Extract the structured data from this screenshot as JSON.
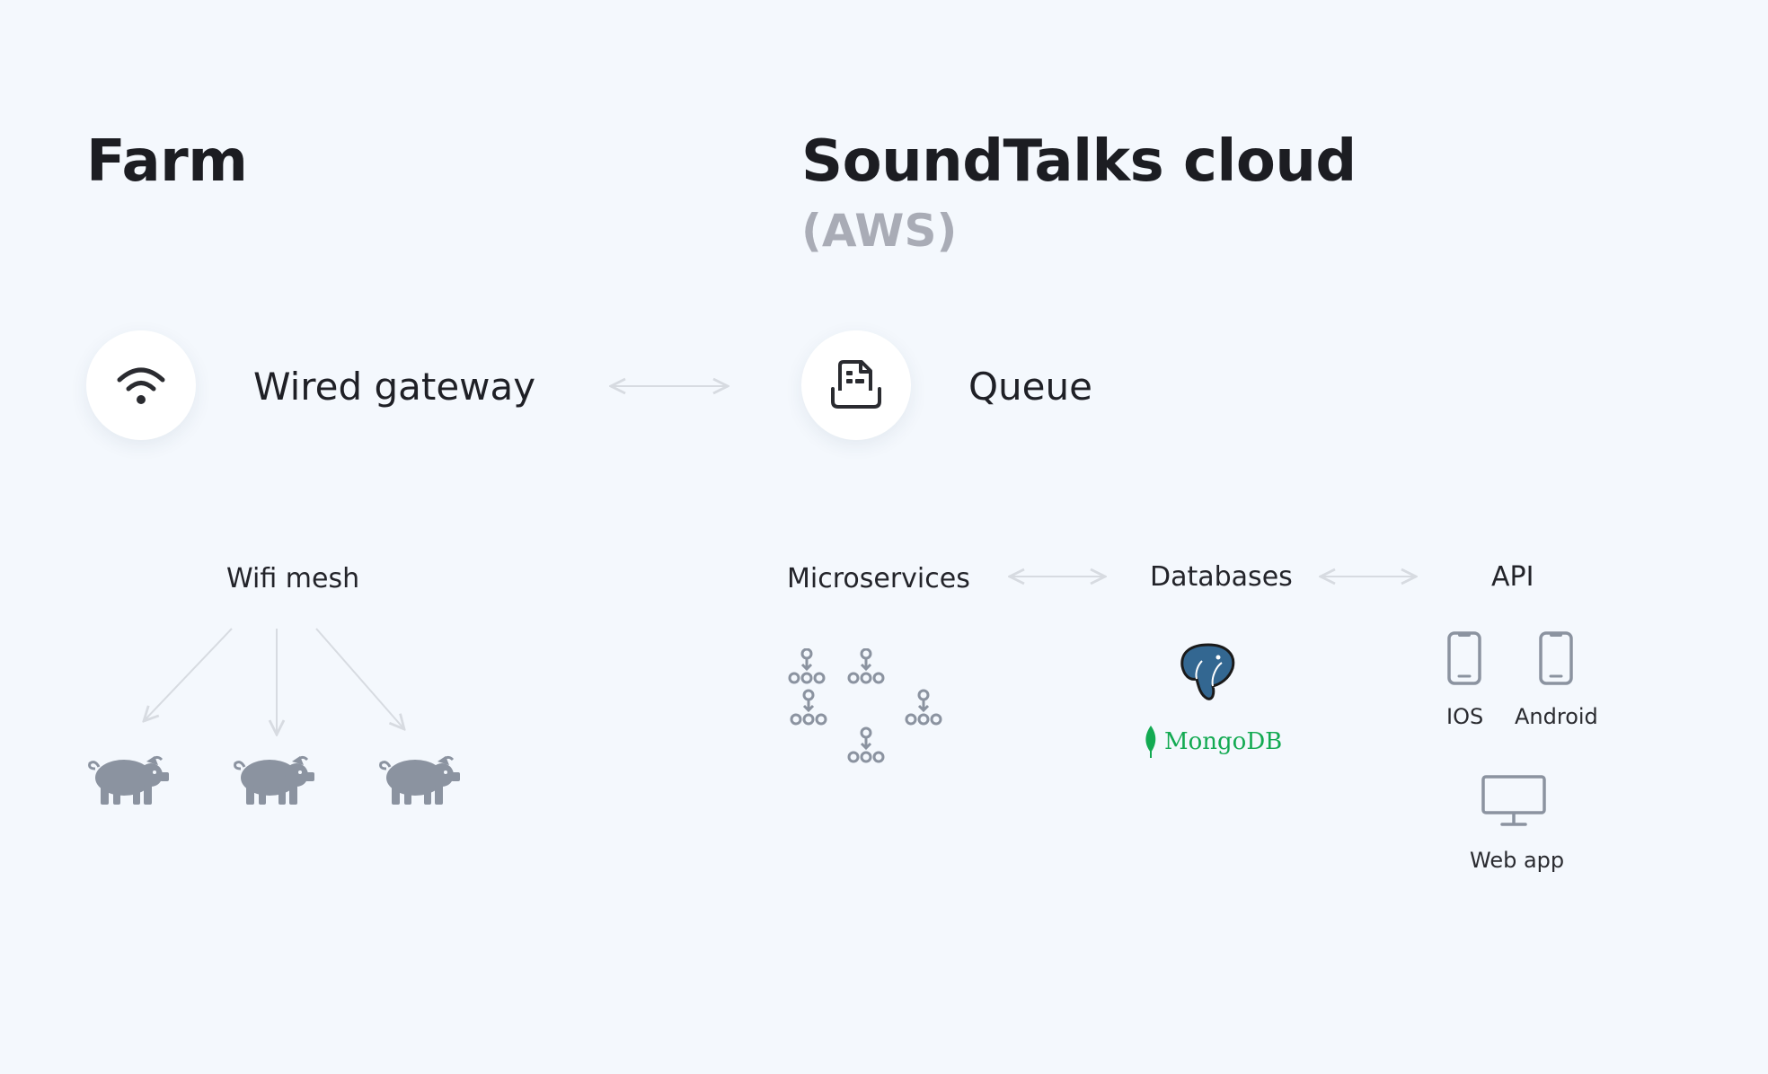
{
  "farm": {
    "title": "Farm",
    "gateway_label": "Wired gateway",
    "gateway_icon": "wifi-icon",
    "mesh_label": "Wifi mesh",
    "devices": [
      "pig-icon",
      "pig-icon",
      "pig-icon"
    ]
  },
  "cloud": {
    "title": "SoundTalks cloud",
    "subtitle": "(AWS)",
    "queue_label": "Queue",
    "queue_icon": "queue-document-icon",
    "microservices_label": "Microservices",
    "databases_label": "Databases",
    "mongodb_label": "MongoDB",
    "api_label": "API",
    "clients": {
      "ios_label": "IOS",
      "android_label": "Android",
      "web_label": "Web app"
    }
  },
  "colors": {
    "background": "#f4f8fd",
    "text": "#1c1d22",
    "muted": "#a9acb6",
    "icon_gray": "#8b93a0",
    "connector": "#d7dbe1",
    "postgres_blue": "#336791",
    "mongo_green": "#13aa52"
  }
}
